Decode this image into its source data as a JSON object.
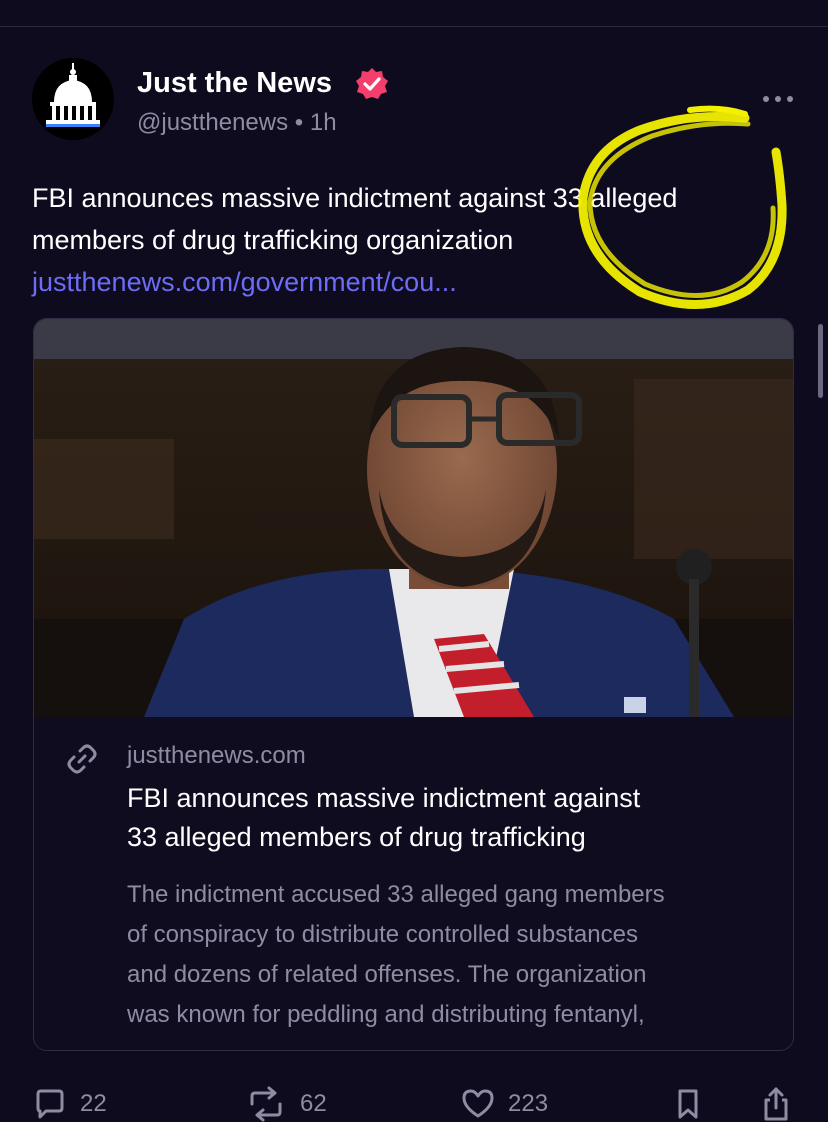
{
  "post": {
    "author": {
      "display_name": "Just the News",
      "handle": "@justthenews",
      "separator": "•",
      "time": "1h",
      "avatar_icon": "capitol-dome-icon",
      "verified_icon": "verified-badge-icon"
    },
    "text_lines": [
      "FBI announces massive indictment against 33 alleged",
      "members of drug trafficking organization"
    ],
    "link_text": "justthenews.com/government/cou...",
    "more_icon": "more-dots-icon"
  },
  "card": {
    "domain": "justthenews.com",
    "title_lines": [
      "FBI announces massive indictment against",
      "33 alleged members of drug trafficking"
    ],
    "description_lines": [
      "The indictment accused 33 alleged gang members",
      "of conspiracy to distribute controlled substances",
      "and dozens of related offenses. The organization",
      "was known for peddling and distributing fentanyl,"
    ],
    "link_icon": "link-icon",
    "image_icon": "article-photo"
  },
  "actions": {
    "replies": "22",
    "reposts": "62",
    "likes": "223",
    "reply_icon": "reply-icon",
    "repost_icon": "repost-icon",
    "like_icon": "heart-icon",
    "bookmark_icon": "bookmark-icon",
    "share_icon": "share-icon"
  },
  "colors": {
    "background": "#0f0b1e",
    "link": "#6c6cf6",
    "muted": "#8f8ba3",
    "verified": "#f43f6c",
    "highlight_scribble": "#f4f000"
  }
}
